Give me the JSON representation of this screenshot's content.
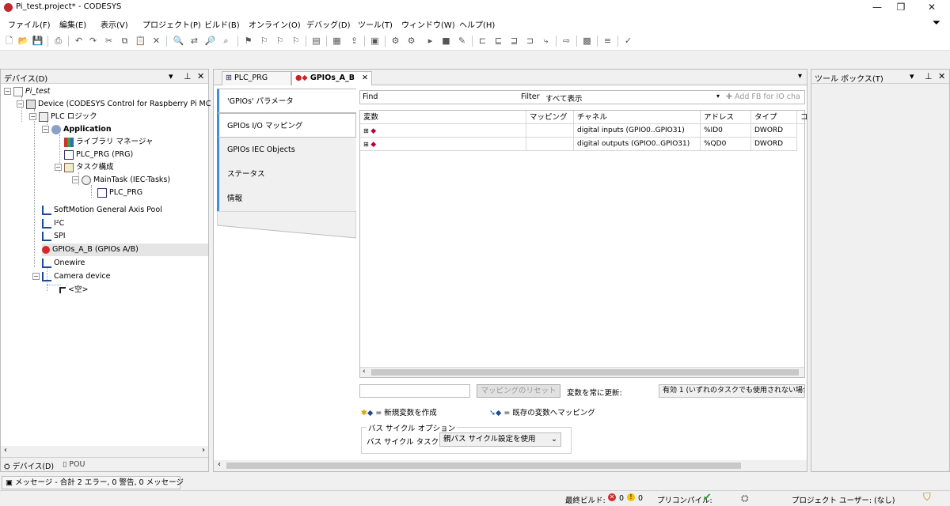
{
  "window": {
    "title": "Pi_test.project* - CODESYS"
  },
  "menu": [
    "ファイル(F)",
    "編集(E)",
    "表示(V)",
    "プロジェクト(P)",
    "ビルド(B)",
    "オンライン(O)",
    "デバッグ(D)",
    "ツール(T)",
    "ウィンドウ(W)",
    "ヘルプ(H)"
  ],
  "devices_panel": {
    "title": "デバイス(D)",
    "tree": [
      {
        "label": "Pi_test",
        "italic": true
      },
      {
        "label": "Device (CODESYS Control for Raspberry Pi MC SL"
      },
      {
        "label": "PLC ロジック"
      },
      {
        "label": "Application",
        "bold": true
      },
      {
        "label": "ライブラリ マネージャ"
      },
      {
        "label": "PLC_PRG (PRG)"
      },
      {
        "label": "タスク構成"
      },
      {
        "label": "MainTask (IEC-Tasks)"
      },
      {
        "label": "PLC_PRG"
      },
      {
        "label": "SoftMotion General Axis Pool"
      },
      {
        "label": "I²C"
      },
      {
        "label": "SPI"
      },
      {
        "label": "GPIOs_A_B (GPIOs A/B)",
        "selected": true
      },
      {
        "label": "Onewire"
      },
      {
        "label": "Camera device"
      },
      {
        "label": "<空>"
      }
    ],
    "bottom_tabs": [
      "デバイス(D)",
      "POU"
    ]
  },
  "editor": {
    "doc_tabs": [
      {
        "label": "PLC_PRG"
      },
      {
        "label": "GPIOs_A_B",
        "active": true
      }
    ],
    "inner_tabs": [
      "'GPIOs' パラメータ",
      "GPIOs I/O マッピング",
      "GPIOs IEC Objects",
      "ステータス",
      "情報"
    ],
    "find_label": "Find",
    "filter_label": "Filter",
    "filter_value": "すべて表示",
    "add_fb_label": "Add FB for IO cha",
    "columns": [
      "変数",
      "マッピング",
      "チャネル",
      "アドレス",
      "タイプ",
      "コ"
    ],
    "rows": [
      {
        "variable": "",
        "mapping": "",
        "channel": "digital inputs (GPIO0..GPIO31)",
        "address": "%ID0",
        "type": "DWORD"
      },
      {
        "variable": "",
        "mapping": "",
        "channel": "digital outputs (GPIO0..GPIO31)",
        "address": "%QD0",
        "type": "DWORD"
      }
    ],
    "reset_mapping_label": "マッピングのリセット",
    "always_update_label": "変数を常に更新:",
    "always_update_value": "有効 1 (いずれのタスクでも使用されない場合",
    "legend_new": "= 新規変数を作成",
    "legend_existing": "= 既存の変数へマッピング",
    "bus_cycle_group": "バス サイクル オプション",
    "bus_cycle_task_label": "バス サイクル タスク",
    "bus_cycle_task_value": "親バス サイクル設定を使用"
  },
  "toolbox": {
    "title": "ツール ボックス(T)"
  },
  "messages": {
    "text": "メッセージ - 合計 2 エラー, 0 警告, 0 メッセージ"
  },
  "status": {
    "last_build_label": "最終ビルド:",
    "errors": "0",
    "warnings": "0",
    "precompile_label": "プリコンパイル:",
    "project_user": "プロジェクト ユーザー: (なし)"
  }
}
